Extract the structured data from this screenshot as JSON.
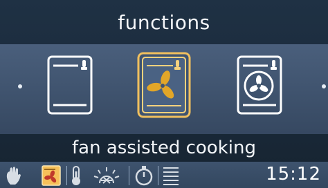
{
  "header": {
    "title": "functions"
  },
  "functions": [
    {
      "name": "conventional-oven-icon",
      "selected": false
    },
    {
      "name": "fan-oven-icon",
      "selected": true
    },
    {
      "name": "fan-assisted-icon",
      "selected": false
    }
  ],
  "main": {
    "selected_label": "fan assisted cooking"
  },
  "statusbar": {
    "icons": [
      "hand-icon",
      "selected-function-icon",
      "thermometer-icon",
      "sun-grid-icon",
      "timer-icon",
      "lines-icon"
    ],
    "time": "15:12"
  },
  "colors": {
    "background": "#1b2a3a",
    "carousel": "#43586f",
    "highlight": "#f1c05e",
    "fan_fill": "#e2a628",
    "icon_stroke": "#ffffff",
    "selected_status": "#f6c05a"
  }
}
